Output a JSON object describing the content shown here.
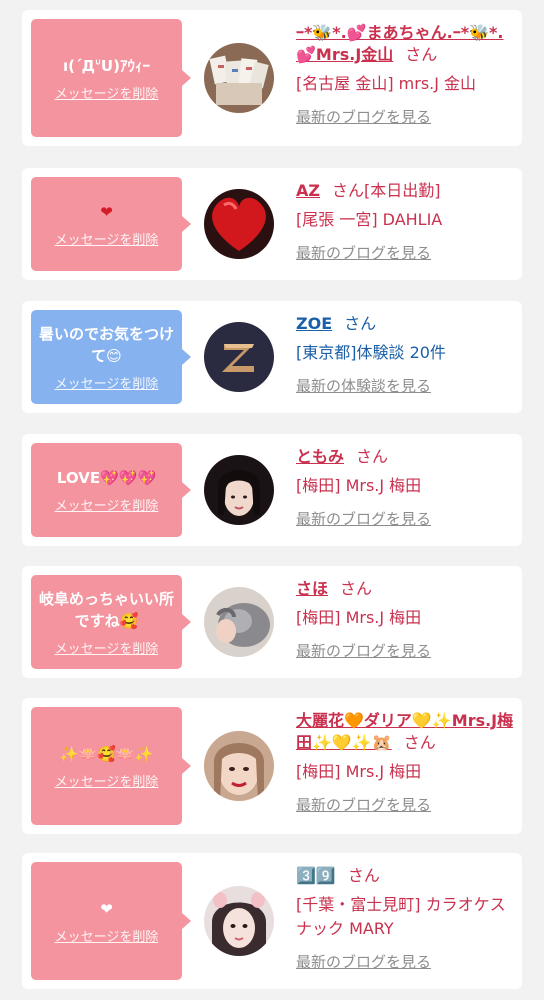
{
  "common": {
    "delete_label": "メッセージを削除",
    "san": "さん"
  },
  "cards": [
    {
      "message": "ı(΄ДᐡU)ｱｳｨｰ",
      "name": "ｰ*🐝*.💕まあちゃん.ｰ*🐝*.💕Mrs.J金山",
      "meta": "[名古屋 金山] mrs.J 金山",
      "blog": "最新のブログを見る"
    },
    {
      "message": "❤",
      "name": "AZ",
      "tag": "[本日出勤]",
      "meta": "[尾張 一宮] DAHLIA",
      "blog": "最新のブログを見る"
    },
    {
      "message": "暑いのでお気をつけて😊",
      "name": "ZOE",
      "meta": "[東京都]体験談 20件",
      "blog": "最新の体験談を見る"
    },
    {
      "message": "LOVE💖💖💖",
      "name": "ともみ",
      "meta": "[梅田] Mrs.J 梅田",
      "blog": "最新のブログを見る"
    },
    {
      "message": "岐阜めっちゃいい所ですね🥰",
      "name": "さほ",
      "meta": "[梅田] Mrs.J 梅田",
      "blog": "最新のブログを見る"
    },
    {
      "message": "✨🪷🥰🪷✨",
      "name": "大麗花🧡ダリア💛✨Mrs.J梅田✨💛✨🐹",
      "meta": "[梅田] Mrs.J 梅田",
      "blog": "最新のブログを見る"
    },
    {
      "message": "❤",
      "name": "3️⃣9️⃣",
      "meta": "[千葉・富士見町] カラオケスナック MARY",
      "blog": "最新のブログを見る"
    }
  ]
}
